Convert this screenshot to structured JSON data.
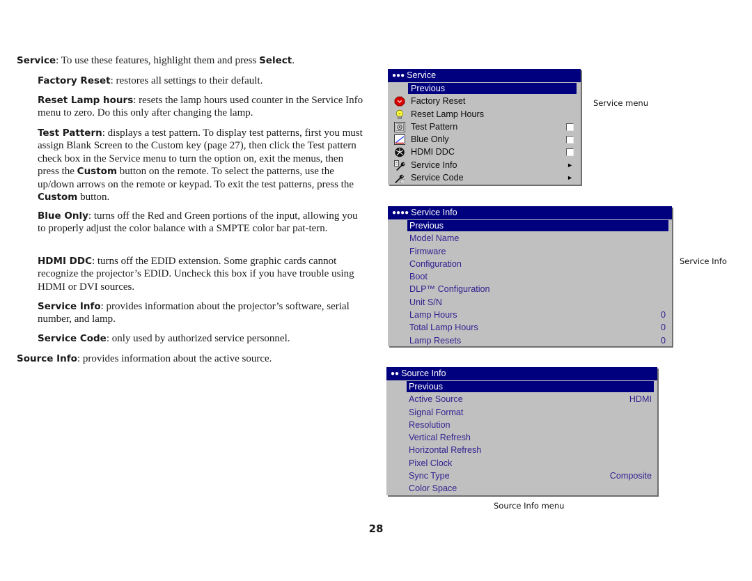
{
  "text": {
    "service": {
      "term": "Service",
      "body_before": ": To use these features, highlight them and press ",
      "key": "Select",
      "body_after": "."
    },
    "factory_reset": {
      "term": "Factory Reset",
      "body": ": restores all settings to their default."
    },
    "reset_lamp": {
      "term": "Reset Lamp hours",
      "body": ": resets the lamp hours used counter in the Service Info menu to zero. Do this only after changing the lamp."
    },
    "test_pattern": {
      "term": "Test Pattern",
      "body1": ": displays a test pattern. To display test patterns, first you must assign Blank Screen to the Custom key (page 27), then click the Test pattern check box in the Service menu to turn the option on, exit the menus, then press the ",
      "key1": "Custom",
      "body2": " button on the remote. To select the patterns, use the up/down arrows on the remote or keypad. To exit the test patterns, press the ",
      "key2": "Custom",
      "body3": " button."
    },
    "blue_only": {
      "term": "Blue Only",
      "body": ": turns off the Red and Green portions of the input, allowing you to properly adjust the color balance with a SMPTE color bar pat-tern."
    },
    "hdmi_ddc": {
      "term": "HDMI DDC",
      "body": ": turns off the EDID extension. Some graphic cards cannot recognize the projector’s EDID. Uncheck this box if you have trouble using HDMI or DVI sources."
    },
    "service_info": {
      "term": "Service Info",
      "body": ": provides information about the projector’s software, serial number, and lamp."
    },
    "service_code": {
      "term": "Service Code",
      "body": ": only used by authorized service personnel."
    },
    "source_info": {
      "term": "Source Info",
      "body": ": provides information about the active source."
    }
  },
  "service_menu": {
    "dots": "●●●",
    "title": "Service",
    "items": [
      {
        "label": "Previous",
        "selected": true
      },
      {
        "label": "Factory Reset",
        "icon": "factory-reset-icon"
      },
      {
        "label": "Reset Lamp Hours",
        "icon": "lamp-bulb-icon"
      },
      {
        "label": "Test Pattern",
        "icon": "test-pattern-icon",
        "control": "checkbox",
        "checked": false
      },
      {
        "label": "Blue Only",
        "icon": "blue-only-icon",
        "control": "checkbox",
        "checked": false
      },
      {
        "label": "HDMI DDC",
        "icon": "hdmi-ddc-icon",
        "control": "checkbox",
        "checked": false
      },
      {
        "label": "Service Info",
        "icon": "service-info-wrench-icon",
        "control": "submenu",
        "arrow": "►"
      },
      {
        "label": "Service Code",
        "icon": "service-code-wrench-icon",
        "control": "submenu",
        "arrow": "►"
      }
    ],
    "caption": "Service menu"
  },
  "service_info_menu": {
    "dots": "●●●●",
    "title": "Service Info",
    "items": [
      {
        "label": "Previous",
        "selected": true
      },
      {
        "label": "Model Name",
        "value": ""
      },
      {
        "label": "Firmware",
        "value": ""
      },
      {
        "label": "Configuration",
        "value": ""
      },
      {
        "label": "Boot",
        "value": ""
      },
      {
        "label": "DLP™ Configuration",
        "value": ""
      },
      {
        "label": "Unit S/N",
        "value": ""
      },
      {
        "label": "Lamp Hours",
        "value": "0"
      },
      {
        "label": "Total Lamp Hours",
        "value": "0"
      },
      {
        "label": "Lamp Resets",
        "value": "0"
      }
    ],
    "caption": "Service Info"
  },
  "source_info_menu": {
    "dots": "●●",
    "title": "Source Info",
    "items": [
      {
        "label": "Previous",
        "selected": true
      },
      {
        "label": "Active Source",
        "value": "HDMI"
      },
      {
        "label": "Signal Format",
        "value": ""
      },
      {
        "label": "Resolution",
        "value": ""
      },
      {
        "label": "Vertical Refresh",
        "value": ""
      },
      {
        "label": "Horizontal Refresh",
        "value": ""
      },
      {
        "label": "Pixel Clock",
        "value": ""
      },
      {
        "label": "Sync Type",
        "value": "Composite"
      },
      {
        "label": "Color Space",
        "value": ""
      }
    ],
    "caption": "Source Info menu"
  },
  "colors": {
    "osd_background": "#c0c0c0",
    "osd_highlight": "#00007f",
    "osd_text": "#2e1f8f"
  },
  "page_number": "28"
}
